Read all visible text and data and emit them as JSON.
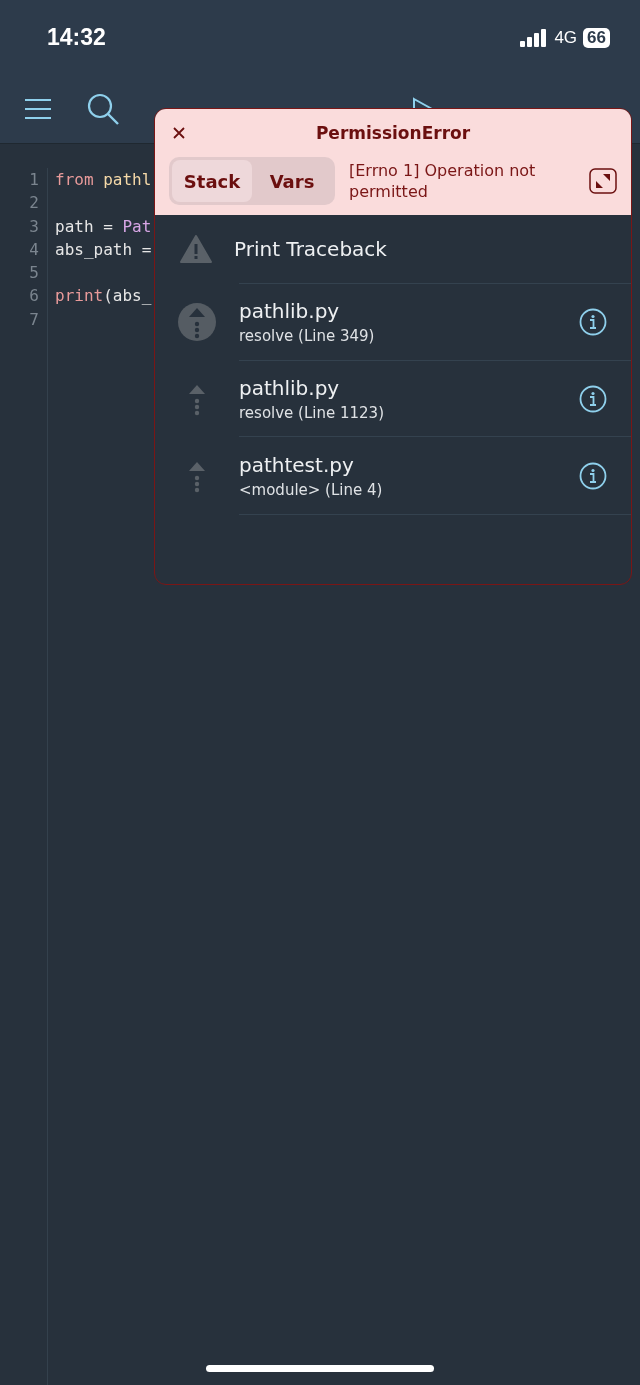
{
  "status_bar": {
    "time": "14:32",
    "network": "4G",
    "battery": "66"
  },
  "editor": {
    "lines": [
      {
        "number": "1",
        "tokens": [
          {
            "kind": "keyword",
            "text": "from"
          },
          {
            "kind": "module",
            "text": "pathl"
          }
        ]
      },
      {
        "number": "2"
      },
      {
        "number": "3",
        "tokens": [
          {
            "kind": "plain",
            "text": "path = "
          },
          {
            "kind": "class",
            "text": "Pat"
          }
        ]
      },
      {
        "number": "4",
        "tokens": [
          {
            "kind": "plain",
            "text": "abs_path ="
          }
        ]
      },
      {
        "number": "5"
      },
      {
        "number": "6",
        "tokens": [
          {
            "kind": "keyword",
            "text": "print"
          },
          {
            "kind": "plain",
            "text": "(abs_"
          }
        ]
      },
      {
        "number": "7"
      }
    ]
  },
  "error_popover": {
    "title": "PermissionError",
    "tabs": [
      {
        "label": "Stack",
        "selected": true
      },
      {
        "label": "Vars",
        "selected": false
      }
    ],
    "message": "[Errno 1] Operation not permitted",
    "print_traceback": "Print Traceback",
    "frames": [
      {
        "file": "pathlib.py",
        "location": "resolve (Line 349)",
        "selected": true
      },
      {
        "file": "pathlib.py",
        "location": "resolve (Line 1123)",
        "selected": false
      },
      {
        "file": "pathtest.py",
        "location": "<module> (Line 4)",
        "selected": false
      }
    ]
  }
}
